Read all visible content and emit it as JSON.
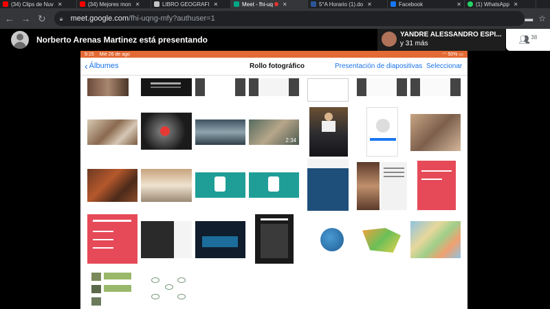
{
  "browser": {
    "tabs": [
      {
        "title": "(34) Clips de Nuv",
        "favicon_color": "#ff0000",
        "active": false
      },
      {
        "title": "(34) Mejores mon",
        "favicon_color": "#ff0000",
        "active": false
      },
      {
        "title": "LIBRO GEOGRAFI",
        "favicon_color": "#c5c5c5",
        "active": false
      },
      {
        "title": "Meet - fhi-uq",
        "favicon_color": "#00a884",
        "active": true
      },
      {
        "title": "5°A Horario (1).do",
        "favicon_color": "#2b579a",
        "active": false
      },
      {
        "title": "Facebook",
        "favicon_color": "#1877f2",
        "active": false
      },
      {
        "title": "(1) WhatsApp",
        "favicon_color": "#25d366",
        "active": false
      }
    ],
    "url_host": "meet.google.com",
    "url_path": "/fhi-uqng-mfy?authuser=1"
  },
  "meet": {
    "presenter_text": "Norberto Arenas Martinez está presentando",
    "participant_name": "YANDRE ALESSANDRO ESPI...",
    "participant_more": "y 31 más",
    "people_count": "38"
  },
  "ipad": {
    "status_time": "9:15",
    "status_date": "Mié 26 de ago",
    "status_battery": "50%",
    "nav_back": "Álbumes",
    "nav_title": "Rollo fotográfico",
    "nav_slideshow": "Presentación de diapositivas",
    "nav_select": "Seleccionar",
    "video_duration": "2:34"
  },
  "colors": {
    "status_bar": "#e36a34",
    "ios_blue": "#1a73e8",
    "chrome_dark": "#35363a"
  }
}
